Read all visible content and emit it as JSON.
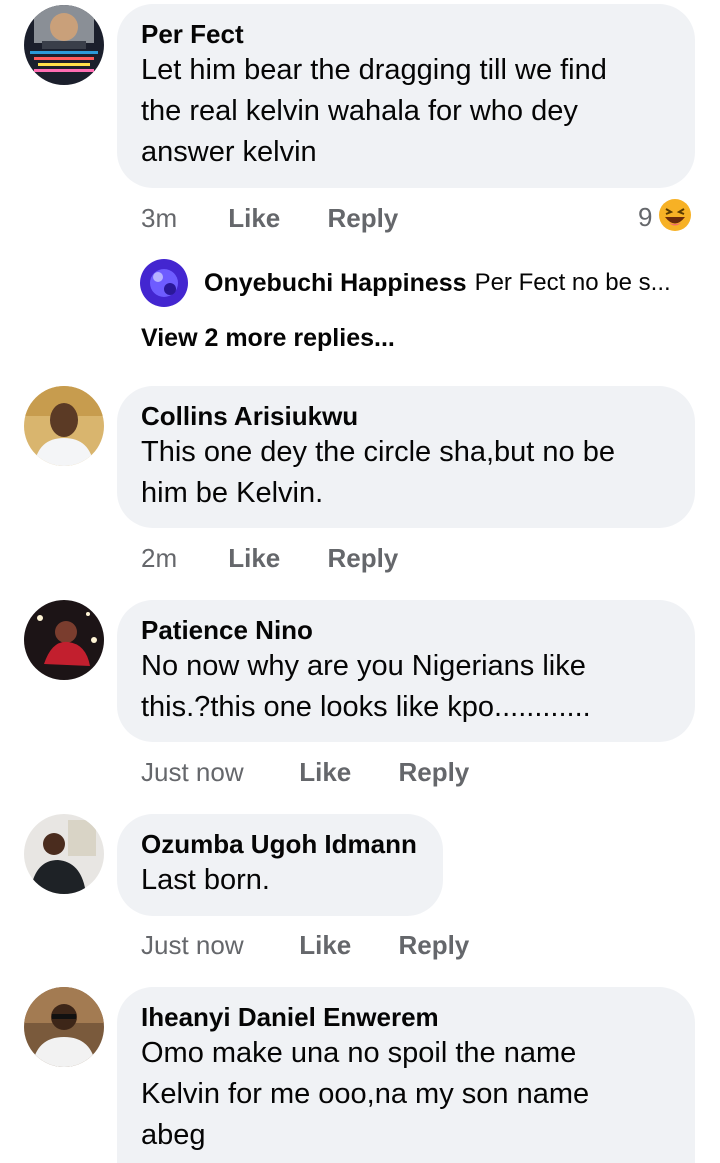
{
  "comments": [
    {
      "author": "Per Fect",
      "lines": [
        "Let him bear the dragging till we find",
        "the real kelvin wahala for who dey",
        "answer kelvin"
      ],
      "time": "3m",
      "like": "Like",
      "reply": "Reply",
      "reaction_count": "9",
      "reaction_icon": "laughing-emoji"
    },
    {
      "author": "Collins Arisiukwu",
      "lines": [
        "This one dey the circle sha,but no be",
        "him be Kelvin."
      ],
      "time": "2m",
      "like": "Like",
      "reply": "Reply"
    },
    {
      "author": "Patience Nino",
      "lines": [
        "No now why are you Nigerians like",
        "this.?this one looks like kpo............"
      ],
      "time": "Just now",
      "like": "Like",
      "reply": "Reply"
    },
    {
      "author": "Ozumba Ugoh Idmann",
      "lines": [
        "Last born."
      ],
      "time": "Just now",
      "like": "Like",
      "reply": "Reply"
    },
    {
      "author": "Iheanyi Daniel Enwerem",
      "lines": [
        "Omo make una no spoil the name",
        "Kelvin for me ooo,na my son name",
        "abeg"
      ]
    }
  ],
  "reply_preview": {
    "author": "Onyebuchi Happiness",
    "text": "Per Fect no be s..."
  },
  "view_more": "View 2 more replies...",
  "colors": {
    "bubble": "#f0f2f5",
    "meta_text": "#65676b",
    "text": "#050505"
  }
}
